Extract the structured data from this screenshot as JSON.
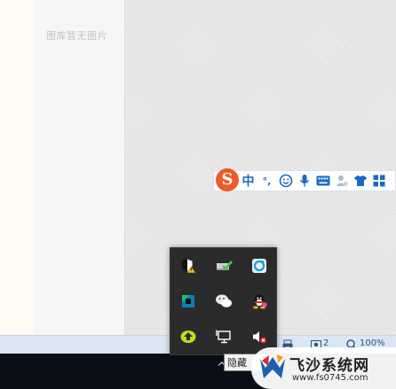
{
  "gallery": {
    "empty_text": "图库暂无图片"
  },
  "ime_toolbar": {
    "logo_text": "S",
    "items": [
      "中",
      "°,",
      "☺",
      "🎤",
      "⌨",
      "👤",
      "👕",
      "▦"
    ]
  },
  "status_bar": {
    "count_text": "2",
    "zoom_text": "100%"
  },
  "tray_overflow": {
    "icons": [
      "security-warning-icon",
      "network-check-icon",
      "browser-refresh-icon",
      "app-cube-icon",
      "wechat-icon",
      "qq-icon",
      "download-sync-icon",
      "display-icon",
      "volume-muted-icon"
    ]
  },
  "taskbar": {
    "chevron": "^",
    "tooltip": "隐藏"
  },
  "watermark": {
    "title": "飞沙系统网",
    "url": "www.fs0745.com"
  }
}
